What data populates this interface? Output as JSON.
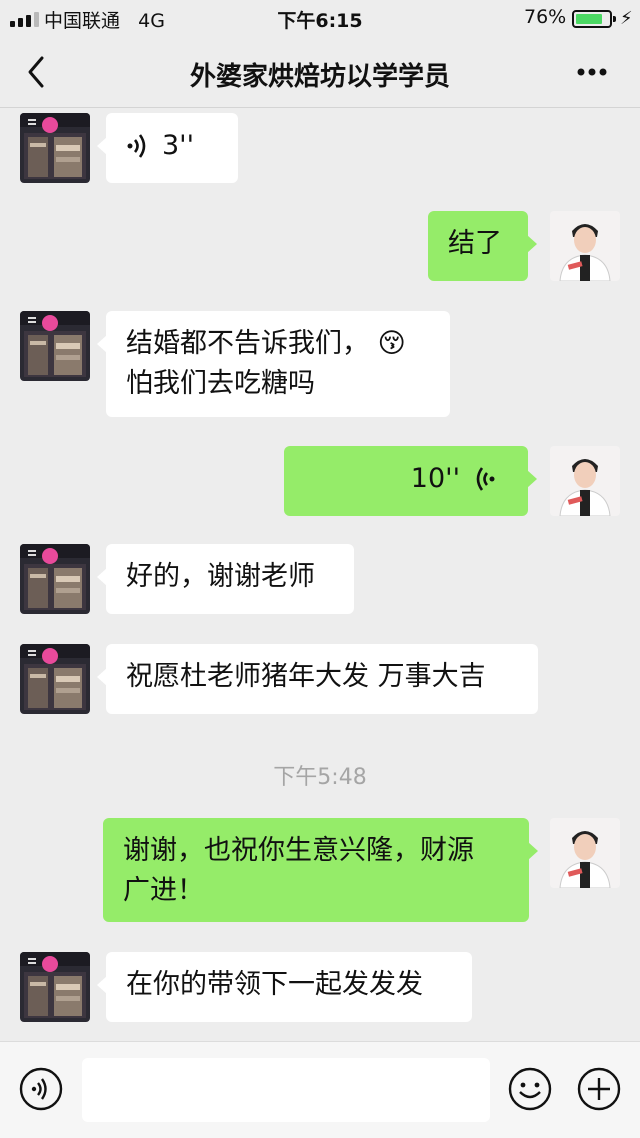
{
  "status_bar": {
    "carrier": "中国联通",
    "network": "4G",
    "time": "下午6:15",
    "battery": "76%"
  },
  "header": {
    "title": "外婆家烘焙坊以学学员",
    "back_icon": "chevron-left-icon",
    "more_icon": "more-dots-icon"
  },
  "messages": [
    {
      "side": "in",
      "type": "voice",
      "duration": "3''"
    },
    {
      "side": "out",
      "type": "text",
      "lines": [
        "结了"
      ]
    },
    {
      "side": "in",
      "type": "text",
      "lines": [
        "结婚都不告诉我们，",
        "怕我们去吃糖吗"
      ],
      "emoji": "😚"
    },
    {
      "side": "out",
      "type": "voice",
      "duration": "10''"
    },
    {
      "side": "in",
      "type": "text",
      "lines": [
        "好的，谢谢老师"
      ]
    },
    {
      "side": "in",
      "type": "text",
      "lines": [
        "祝愿杜老师猪年大发 万事大吉"
      ]
    },
    {
      "side": "out",
      "type": "text",
      "lines": [
        "谢谢，也祝你生意兴隆，财源",
        "广进！"
      ]
    },
    {
      "side": "in",
      "type": "text",
      "lines": [
        "在你的带领下一起发发发"
      ]
    }
  ],
  "timestamp": "下午5:48",
  "input_bar": {
    "voice_icon": "voice-mode-icon",
    "emoji_icon": "emoji-icon",
    "plus_icon": "plus-icon",
    "value": ""
  },
  "colors": {
    "background": "#ededed",
    "bubble_out": "#95ec69",
    "bubble_in": "#ffffff",
    "battery": "#4cd964"
  }
}
